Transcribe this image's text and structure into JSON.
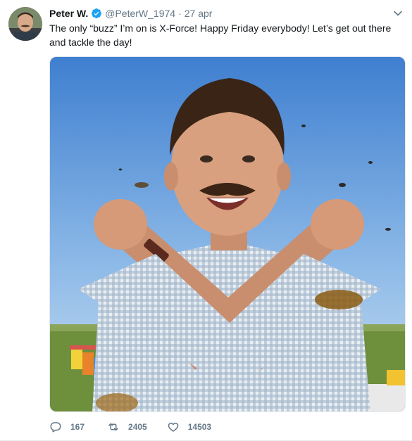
{
  "tweet": {
    "display_name": "Peter W.",
    "handle": "@PeterW_1974",
    "separator": "·",
    "date": "27 apr",
    "text": "The only “buzz” I’m on is X-Force! Happy Friday everybody! Let’s get out there and tackle the day!",
    "verified": true
  },
  "actions": {
    "replies": "167",
    "retweets": "2405",
    "likes": "14503"
  },
  "colors": {
    "verified_blue": "#1da1f2",
    "muted": "#657786",
    "text": "#14171a"
  },
  "icons": {
    "verified": "verified-badge-icon",
    "caret": "chevron-down-icon",
    "reply": "reply-icon",
    "retweet": "retweet-icon",
    "like": "heart-icon"
  }
}
